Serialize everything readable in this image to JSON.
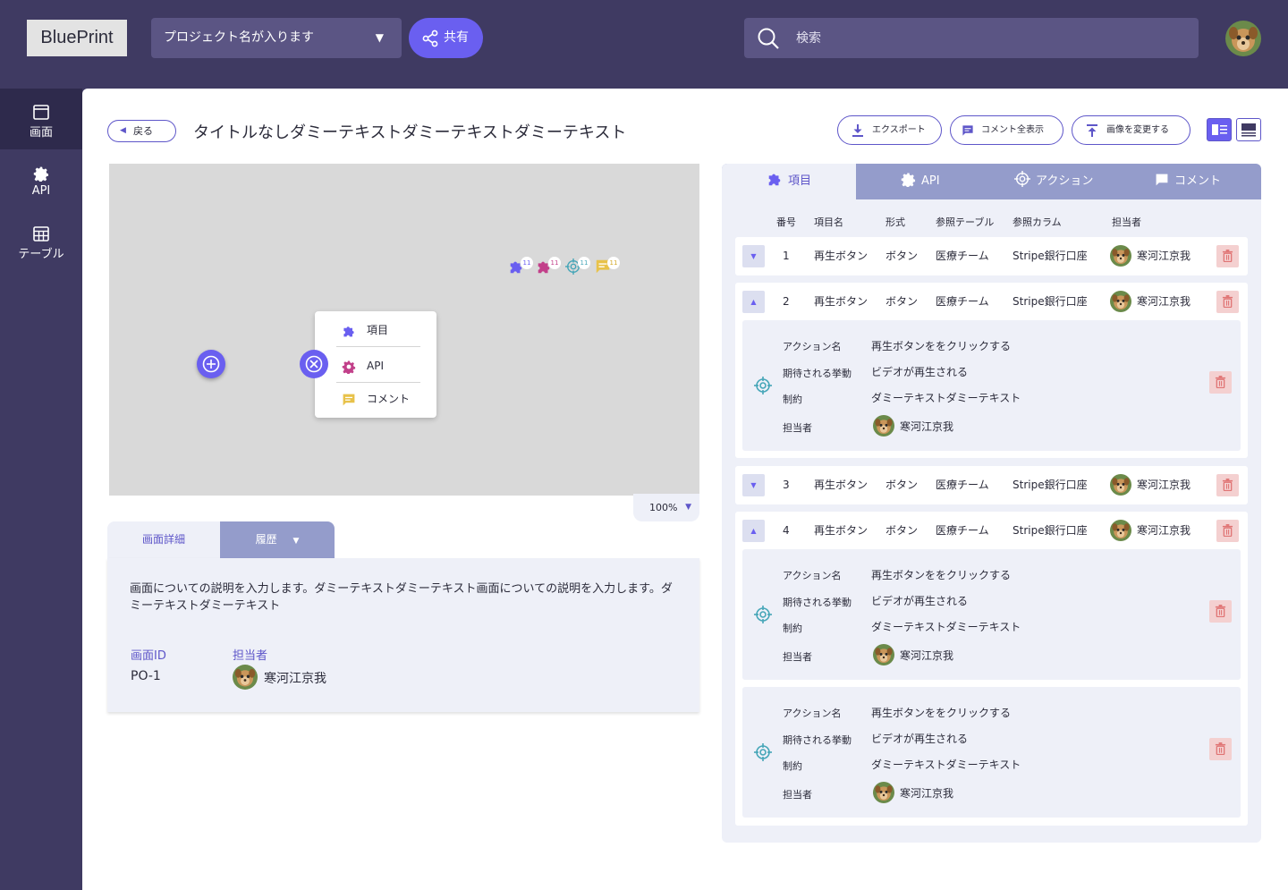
{
  "header": {
    "logo": "BluePrint",
    "project_name": "プロジェクト名が入ります",
    "share_label": "共有",
    "search_placeholder": "検索"
  },
  "sidebar": {
    "items": [
      {
        "label": "画面",
        "icon": "window-icon",
        "active": true
      },
      {
        "label": "API",
        "icon": "gear-icon",
        "active": false
      },
      {
        "label": "テーブル",
        "icon": "table-icon",
        "active": false
      }
    ]
  },
  "toolbar": {
    "back_label": "戻る",
    "title": "タイトルなしダミーテキストダミーテキストダミーテキスト",
    "export_label": "エクスポート",
    "show_comments_label": "コメント全表示",
    "change_image_label": "画像を変更する"
  },
  "canvas": {
    "zoom": "100%",
    "pin_count": "11",
    "menu": {
      "item_label": "項目",
      "api_label": "API",
      "comment_label": "コメント"
    }
  },
  "detail": {
    "tab_detail": "画面詳細",
    "tab_history": "履歴",
    "description": "画面についての説明を入力します。ダミーテキストダミーテキスト画面についての説明を入力します。ダミーテキストダミーテキスト",
    "screen_id_label": "画面ID",
    "screen_id": "PO-1",
    "assignee_label": "担当者",
    "assignee": "寒河江京我"
  },
  "panel": {
    "tabs": [
      "項目",
      "API",
      "アクション",
      "コメント"
    ],
    "columns": [
      "番号",
      "項目名",
      "形式",
      "参照テーブル",
      "参照カラム",
      "担当者"
    ],
    "rows": [
      {
        "no": "1",
        "name": "再生ボタン",
        "format": "ボタン",
        "ref_table": "医療チーム",
        "ref_column": "Stripe銀行口座",
        "assignee": "寒河江京我",
        "expanded": false
      },
      {
        "no": "2",
        "name": "再生ボタン",
        "format": "ボタン",
        "ref_table": "医療チーム",
        "ref_column": "Stripe銀行口座",
        "assignee": "寒河江京我",
        "expanded": true
      },
      {
        "no": "3",
        "name": "再生ボタン",
        "format": "ボタン",
        "ref_table": "医療チーム",
        "ref_column": "Stripe銀行口座",
        "assignee": "寒河江京我",
        "expanded": false
      },
      {
        "no": "4",
        "name": "再生ボタン",
        "format": "ボタン",
        "ref_table": "医療チーム",
        "ref_column": "Stripe銀行口座",
        "assignee": "寒河江京我",
        "expanded": true
      }
    ],
    "action_labels": {
      "name": "アクション名",
      "expected": "期待される挙動",
      "constraint": "制約",
      "assignee": "担当者"
    },
    "action": {
      "name": "再生ボタンををクリックする",
      "expected": "ビデオが再生される",
      "constraint": "ダミーテキストダミーテキスト",
      "assignee": "寒河江京我"
    }
  },
  "colors": {
    "primary": "#6a5ff0",
    "sidebar_bg": "#3f3a62",
    "tab_inactive": "#949ccb",
    "panel_bg": "#eef0f8",
    "danger_bg": "#f4d0d0",
    "danger": "#e07474"
  }
}
